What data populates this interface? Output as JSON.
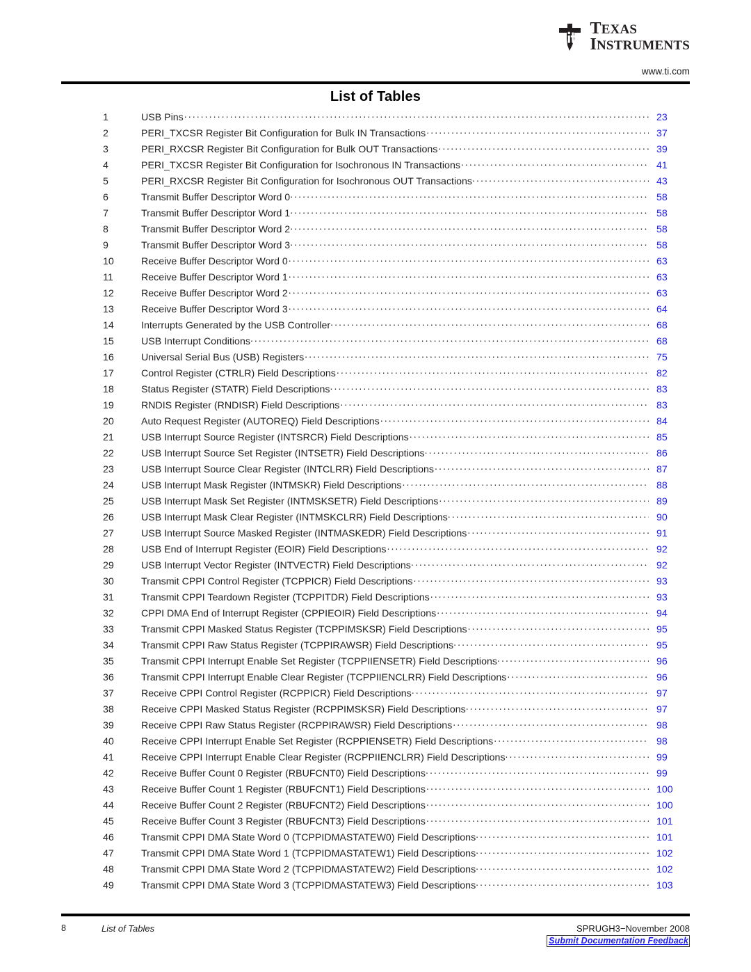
{
  "header": {
    "logo_icon": "ti-logo-icon",
    "brand_line1": "Texas",
    "brand_line2": "Instruments",
    "url": "www.ti.com"
  },
  "title": "List of Tables",
  "colors": {
    "link_blue": "#1d1df0",
    "text": "#221f1f",
    "rule": "#000000"
  },
  "entries": [
    {
      "num": "1",
      "label": "USB Pins",
      "page": "23",
      "tight": false
    },
    {
      "num": "2",
      "label": "PERI_TXCSR Register Bit Configuration for Bulk IN Transactions",
      "page": "37",
      "tight": false
    },
    {
      "num": "3",
      "label": "PERI_RXCSR Register Bit Configuration for Bulk OUT Transactions",
      "page": "39",
      "tight": false
    },
    {
      "num": "4",
      "label": "PERI_TXCSR Register Bit Configuration for Isochronous IN Transactions",
      "page": "41",
      "tight": false
    },
    {
      "num": "5",
      "label": "PERI_RXCSR Register Bit Configuration for Isochronous OUT Transactions",
      "page": "43",
      "tight": true
    },
    {
      "num": "6",
      "label": "Transmit Buffer Descriptor Word 0",
      "page": "58",
      "tight": true
    },
    {
      "num": "7",
      "label": "Transmit Buffer Descriptor Word 1",
      "page": "58",
      "tight": true
    },
    {
      "num": "8",
      "label": "Transmit Buffer Descriptor Word 2",
      "page": "58",
      "tight": true
    },
    {
      "num": "9",
      "label": "Transmit Buffer Descriptor Word 3",
      "page": "58",
      "tight": true
    },
    {
      "num": "10",
      "label": "Receive Buffer Descriptor Word 0",
      "page": "63",
      "tight": false
    },
    {
      "num": "11",
      "label": "Receive Buffer Descriptor Word 1",
      "page": "63",
      "tight": false
    },
    {
      "num": "12",
      "label": "Receive Buffer Descriptor Word 2",
      "page": "63",
      "tight": false
    },
    {
      "num": "13",
      "label": "Receive Buffer Descriptor Word 3",
      "page": "64",
      "tight": false
    },
    {
      "num": "14",
      "label": "Interrupts Generated by the USB Controller",
      "page": "68",
      "tight": true
    },
    {
      "num": "15",
      "label": "USB Interrupt Conditions",
      "page": "68",
      "tight": true
    },
    {
      "num": "16",
      "label": "Universal Serial Bus (USB) Registers",
      "page": "75",
      "tight": false
    },
    {
      "num": "17",
      "label": "Control Register (CTRLR) Field Descriptions",
      "page": "82",
      "tight": false
    },
    {
      "num": "18",
      "label": "Status Register (STATR) Field Descriptions",
      "page": "83",
      "tight": true
    },
    {
      "num": "19",
      "label": "RNDIS Register (RNDISR) Field Descriptions",
      "page": "83",
      "tight": false
    },
    {
      "num": "20",
      "label": "Auto Request Register (AUTOREQ) Field Descriptions",
      "page": "84",
      "tight": false
    },
    {
      "num": "21",
      "label": "USB Interrupt Source Register (INTSRCR) Field Descriptions",
      "page": "85",
      "tight": false
    },
    {
      "num": "22",
      "label": "USB Interrupt Source Set Register (INTSETR) Field Descriptions",
      "page": "86",
      "tight": true
    },
    {
      "num": "23",
      "label": "USB Interrupt Source Clear Register (INTCLRR) Field Descriptions",
      "page": "87",
      "tight": false
    },
    {
      "num": "24",
      "label": "USB Interrupt Mask Register (INTMSKR) Field Descriptions",
      "page": "88",
      "tight": false
    },
    {
      "num": "25",
      "label": "USB Interrupt Mask Set Register (INTMSKSETR) Field Descriptions",
      "page": "89",
      "tight": false
    },
    {
      "num": "26",
      "label": "USB Interrupt Mask Clear Register (INTMSKCLRR) Field Descriptions",
      "page": "90",
      "tight": true
    },
    {
      "num": "27",
      "label": "USB Interrupt Source Masked Register (INTMASKEDR) Field Descriptions",
      "page": "91",
      "tight": false
    },
    {
      "num": "28",
      "label": "USB End of Interrupt Register (EOIR) Field Descriptions",
      "page": "92",
      "tight": false
    },
    {
      "num": "29",
      "label": "USB Interrupt Vector Register (INTVECTR) Field Descriptions",
      "page": "92",
      "tight": true
    },
    {
      "num": "30",
      "label": "Transmit CPPI Control Register (TCPPICR) Field Descriptions",
      "page": "93",
      "tight": false
    },
    {
      "num": "31",
      "label": "Transmit CPPI Teardown Register (TCPPITDR) Field Descriptions",
      "page": "93",
      "tight": false
    },
    {
      "num": "32",
      "label": "CPPI DMA End of Interrupt Register (CPPIEOIR) Field Descriptions",
      "page": "94",
      "tight": false
    },
    {
      "num": "33",
      "label": "Transmit CPPI Masked Status Register (TCPPIMSKSR) Field Descriptions",
      "page": "95",
      "tight": false
    },
    {
      "num": "34",
      "label": "Transmit CPPI Raw Status Register (TCPPIRAWSR) Field Descriptions",
      "page": "95",
      "tight": true
    },
    {
      "num": "35",
      "label": "Transmit CPPI Interrupt Enable Set Register (TCPPIIENSETR) Field Descriptions",
      "page": "96",
      "tight": true
    },
    {
      "num": "36",
      "label": "Transmit CPPI Interrupt Enable Clear Register (TCPPIIENCLRR) Field Descriptions",
      "page": "96",
      "tight": false
    },
    {
      "num": "37",
      "label": "Receive CPPI Control Register (RCPPICR) Field Descriptions",
      "page": "97",
      "tight": true
    },
    {
      "num": "38",
      "label": "Receive CPPI Masked Status Register (RCPPIMSKSR) Field Descriptions",
      "page": "97",
      "tight": true
    },
    {
      "num": "39",
      "label": "Receive CPPI Raw Status Register (RCPPIRAWSR) Field Descriptions",
      "page": "98",
      "tight": false
    },
    {
      "num": "40",
      "label": "Receive CPPI Interrupt Enable Set Register (RCPPIENSETR) Field Descriptions",
      "page": "98",
      "tight": false
    },
    {
      "num": "41",
      "label": "Receive CPPI Interrupt Enable Clear Register (RCPPIIENCLRR) Field Descriptions",
      "page": "99",
      "tight": true
    },
    {
      "num": "42",
      "label": "Receive Buffer Count 0 Register (RBUFCNT0) Field Descriptions",
      "page": "99",
      "tight": true
    },
    {
      "num": "43",
      "label": "Receive Buffer Count 1 Register (RBUFCNT1) Field Descriptions",
      "page": "100",
      "tight": false
    },
    {
      "num": "44",
      "label": "Receive Buffer Count 2 Register (RBUFCNT2) Field Descriptions",
      "page": "100",
      "tight": false
    },
    {
      "num": "45",
      "label": "Receive Buffer Count 3 Register (RBUFCNT3) Field Descriptions",
      "page": "101",
      "tight": false
    },
    {
      "num": "46",
      "label": "Transmit CPPI DMA State Word 0 (TCPPIDMASTATEW0) Field Descriptions",
      "page": "101",
      "tight": true
    },
    {
      "num": "47",
      "label": "Transmit CPPI DMA State Word 1 (TCPPIDMASTATEW1) Field Descriptions",
      "page": "102",
      "tight": true
    },
    {
      "num": "48",
      "label": "Transmit CPPI DMA State Word 2 (TCPPIDMASTATEW2) Field Descriptions",
      "page": "102",
      "tight": true
    },
    {
      "num": "49",
      "label": "Transmit CPPI DMA State Word 3 (TCPPIDMASTATEW3) Field Descriptions",
      "page": "103",
      "tight": true
    }
  ],
  "footer": {
    "page_number": "8",
    "section": "List of Tables",
    "doc_id": "SPRUGH3−November 2008",
    "feedback_link": "Submit Documentation Feedback"
  }
}
